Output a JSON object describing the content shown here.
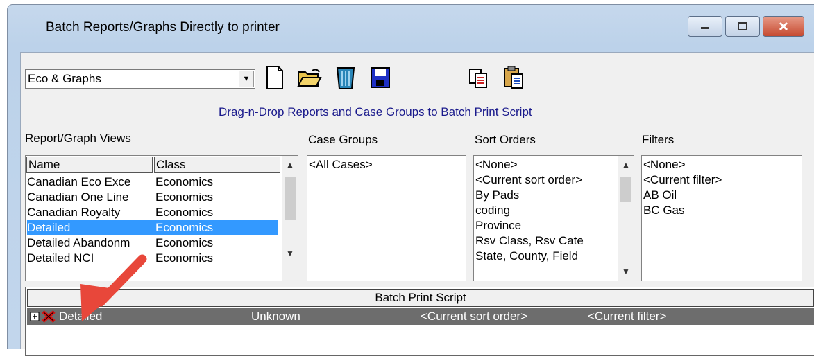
{
  "window": {
    "title": "Batch Reports/Graphs Directly to printer",
    "minimize_icon": "minimize-icon",
    "maximize_icon": "maximize-icon",
    "close_icon": "close-icon"
  },
  "toolbar": {
    "combo_value": "Eco & Graphs",
    "buttons": [
      "new-document-icon",
      "open-folder-icon",
      "trash-icon",
      "save-icon",
      "copy-icon",
      "paste-icon"
    ]
  },
  "hint_text": "Drag-n-Drop Reports and Case Groups to Batch Print Script",
  "report_views": {
    "label": "Report/Graph Views",
    "columns": [
      "Name",
      "Class"
    ],
    "rows": [
      {
        "name": "Canadian Eco Exce",
        "class": "Economics"
      },
      {
        "name": "Canadian One Line",
        "class": "Economics"
      },
      {
        "name": "Canadian Royalty",
        "class": "Economics"
      },
      {
        "name": "Detailed",
        "class": "Economics",
        "selected": true
      },
      {
        "name": "Detailed Abandonm",
        "class": "Economics"
      },
      {
        "name": "Detailed NCI",
        "class": "Economics"
      }
    ]
  },
  "case_groups": {
    "label": "Case Groups",
    "items": [
      "<All Cases>"
    ]
  },
  "sort_orders": {
    "label": "Sort Orders",
    "items": [
      "<None>",
      "<Current sort order>",
      "By Pads",
      "coding",
      "Province",
      "Rsv Class, Rsv Cate",
      "State, County, Field"
    ]
  },
  "filters": {
    "label": "Filters",
    "items": [
      "<None>",
      "<Current filter>",
      "AB Oil",
      "BC Gas"
    ]
  },
  "batch_script": {
    "header": "Batch Print Script",
    "rows": [
      {
        "name": "Detailed",
        "case_group": "Unknown",
        "sort_order": "<Current sort order>",
        "filter": "<Current filter>"
      }
    ]
  },
  "colors": {
    "selection": "#3399ff",
    "batch_row": "#6d6d6d",
    "annotation_arrow": "#e8473a"
  }
}
